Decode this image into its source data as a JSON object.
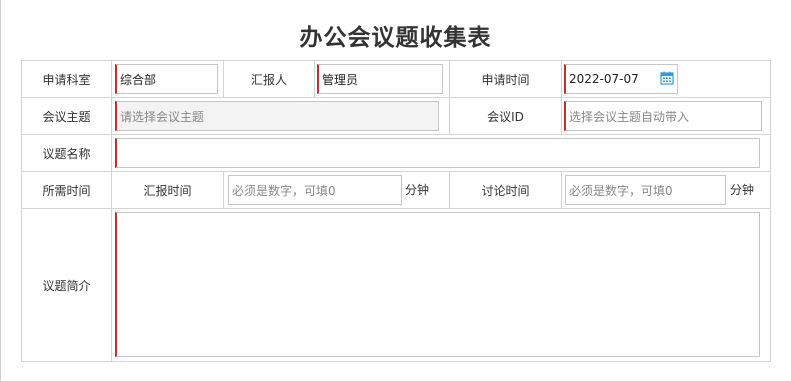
{
  "form": {
    "title": "办公会议题收集表",
    "labels": {
      "department": "申请科室",
      "reporter": "汇报人",
      "apply_time": "申请时间",
      "meeting_topic": "会议主题",
      "meeting_id": "会议ID",
      "agenda_name": "议题名称",
      "time_needed": "所需时间",
      "report_time": "汇报时间",
      "discuss_time": "讨论时间",
      "agenda_intro": "议题简介"
    },
    "values": {
      "department": "综合部",
      "reporter": "管理员",
      "apply_time": "2022-07-07",
      "meeting_topic": "",
      "meeting_id": "",
      "agenda_name": "",
      "report_time": "",
      "discuss_time": "",
      "agenda_intro": ""
    },
    "placeholders": {
      "meeting_topic": "请选择会议主题",
      "meeting_id": "选择会议主题自动带入",
      "report_time": "必须是数字，可填0",
      "discuss_time": "必须是数字，可填0"
    },
    "units": {
      "report_time": "分钟",
      "discuss_time": "分钟"
    }
  },
  "colors": {
    "required_border": "#c0312b",
    "grid_line": "#d4d4d4",
    "calendar_icon": "#2e9fd8"
  },
  "icons": {
    "calendar": "calendar-icon"
  }
}
